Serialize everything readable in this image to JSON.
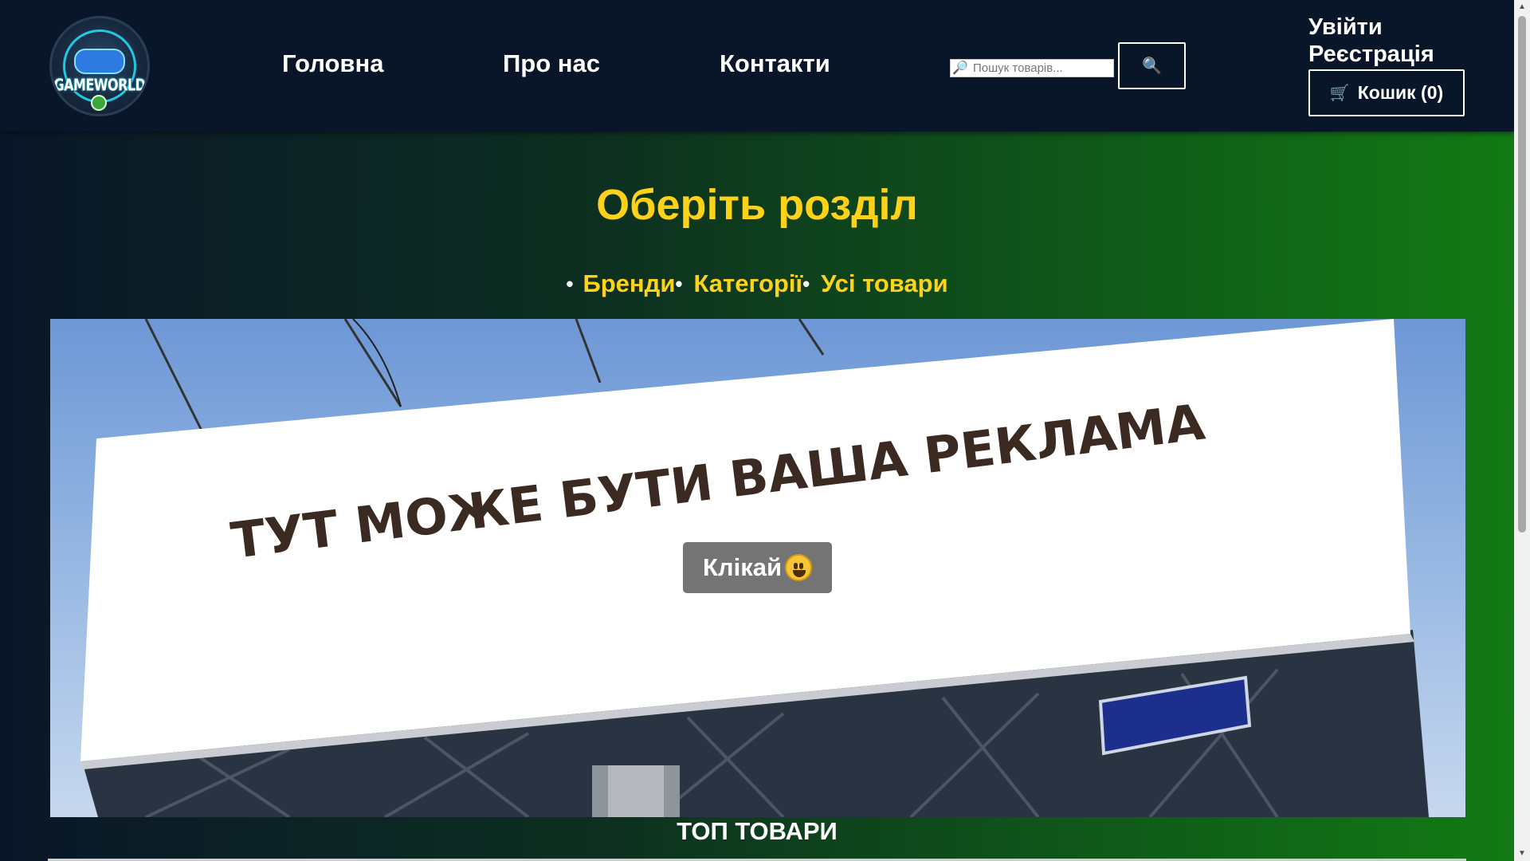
{
  "header": {
    "logo_text": "GAMEWORLD",
    "nav": [
      "Головна",
      "Про нас",
      "Контакти"
    ],
    "search": {
      "placeholder": "Пошук товарів...",
      "value": "",
      "button_icon": "🔍",
      "input_icon": "🔎"
    },
    "auth": {
      "login": "Увійти",
      "register": "Реєстрація"
    },
    "cart": {
      "icon": "🛒",
      "label": "Кошик (0)"
    }
  },
  "main": {
    "title": "Оберіть розділ",
    "sections": [
      "Бренди",
      "Категорії",
      "Усі товари"
    ],
    "banner": {
      "text": "ТУТ МОЖЕ БУТИ ВАША РЕКЛАМА",
      "button_label": "Клікай"
    },
    "top_products_title": "ТОП ТОВАРИ"
  },
  "colors": {
    "header_bg": "#091629",
    "accent_yellow": "#ffd21a",
    "gradient_start": "#0a1628",
    "gradient_end": "#127a14",
    "button_gray": "#747474"
  }
}
